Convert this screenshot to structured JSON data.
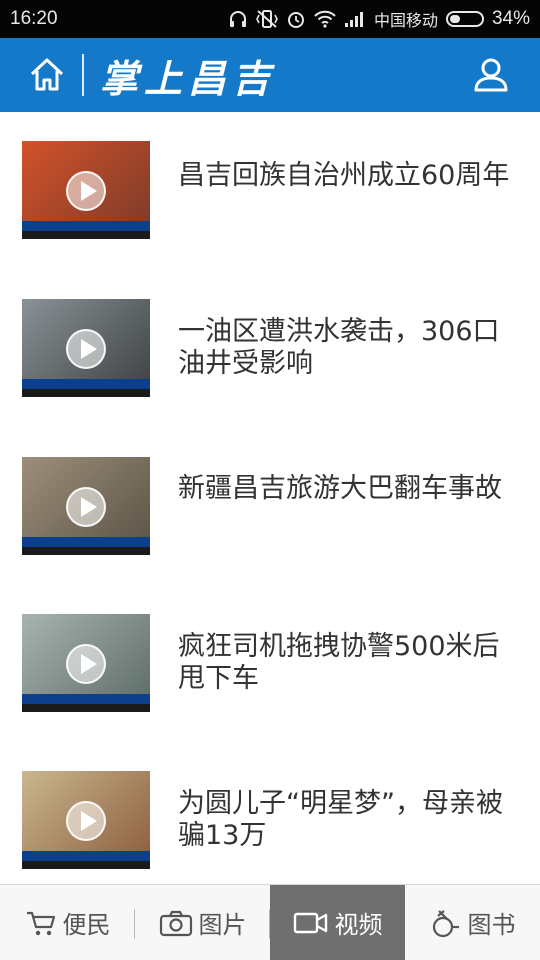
{
  "status_bar": {
    "time": "16:20",
    "carrier": "中国移动",
    "battery_percent": 34,
    "battery_text": "34%",
    "icons": [
      "headphones-icon",
      "vibrate-off-icon",
      "alarm-icon",
      "wifi-icon",
      "signal-icon"
    ]
  },
  "header": {
    "title": "掌上昌吉",
    "background": "#1479c8",
    "home_icon": "home-icon",
    "user_icon": "user-icon"
  },
  "news": [
    {
      "title": "昌吉回族自治州成立60周年",
      "thumb_colors": [
        "#d2522a",
        "#7a3a2a"
      ]
    },
    {
      "title": "一油区遭洪水袭击，306口油井受影响",
      "thumb_colors": [
        "#8a9296",
        "#3b3f40"
      ]
    },
    {
      "title": "新疆昌吉旅游大巴翻车事故",
      "thumb_colors": [
        "#9d8f7a",
        "#5a5246"
      ]
    },
    {
      "title": "疯狂司机拖拽协警500米后甩下车",
      "thumb_colors": [
        "#a9b3b0",
        "#5b6a66"
      ]
    },
    {
      "title": "为圆儿子“明星梦”，母亲被骗13万",
      "thumb_colors": [
        "#c9b78f",
        "#8b5a3c"
      ]
    }
  ],
  "bottom_nav": [
    {
      "label": "便民",
      "icon": "cart-icon",
      "active": false
    },
    {
      "label": "图片",
      "icon": "camera-icon",
      "active": false
    },
    {
      "label": "视频",
      "icon": "video-camera-icon",
      "active": true
    },
    {
      "label": "图书",
      "icon": "book-icon",
      "active": false
    }
  ]
}
